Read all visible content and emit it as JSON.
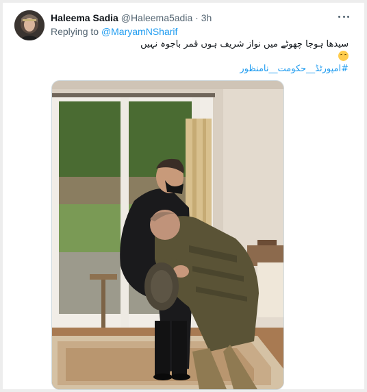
{
  "tweet": {
    "display_name": "Haleema Sadia",
    "handle": "@Haleema5adia",
    "separator": "·",
    "time": "3h",
    "reply_prefix": "Replying to",
    "reply_to": "@MaryamNSharif",
    "text": "سیدھا ہوجا چھوٹے میں نواز شریف ہوں قمر باجوہ نہیں",
    "hashtag": "#امپورٹڈ__حکومت__نامنظور",
    "emoji": "hugging-face-emoji"
  },
  "icons": {
    "more": "more-horizontal-icon",
    "avatar": "profile-avatar"
  },
  "colors": {
    "link": "#1d9bf0",
    "text_primary": "#0f1419",
    "text_secondary": "#536471",
    "background": "#ededed",
    "card": "#ffffff"
  }
}
